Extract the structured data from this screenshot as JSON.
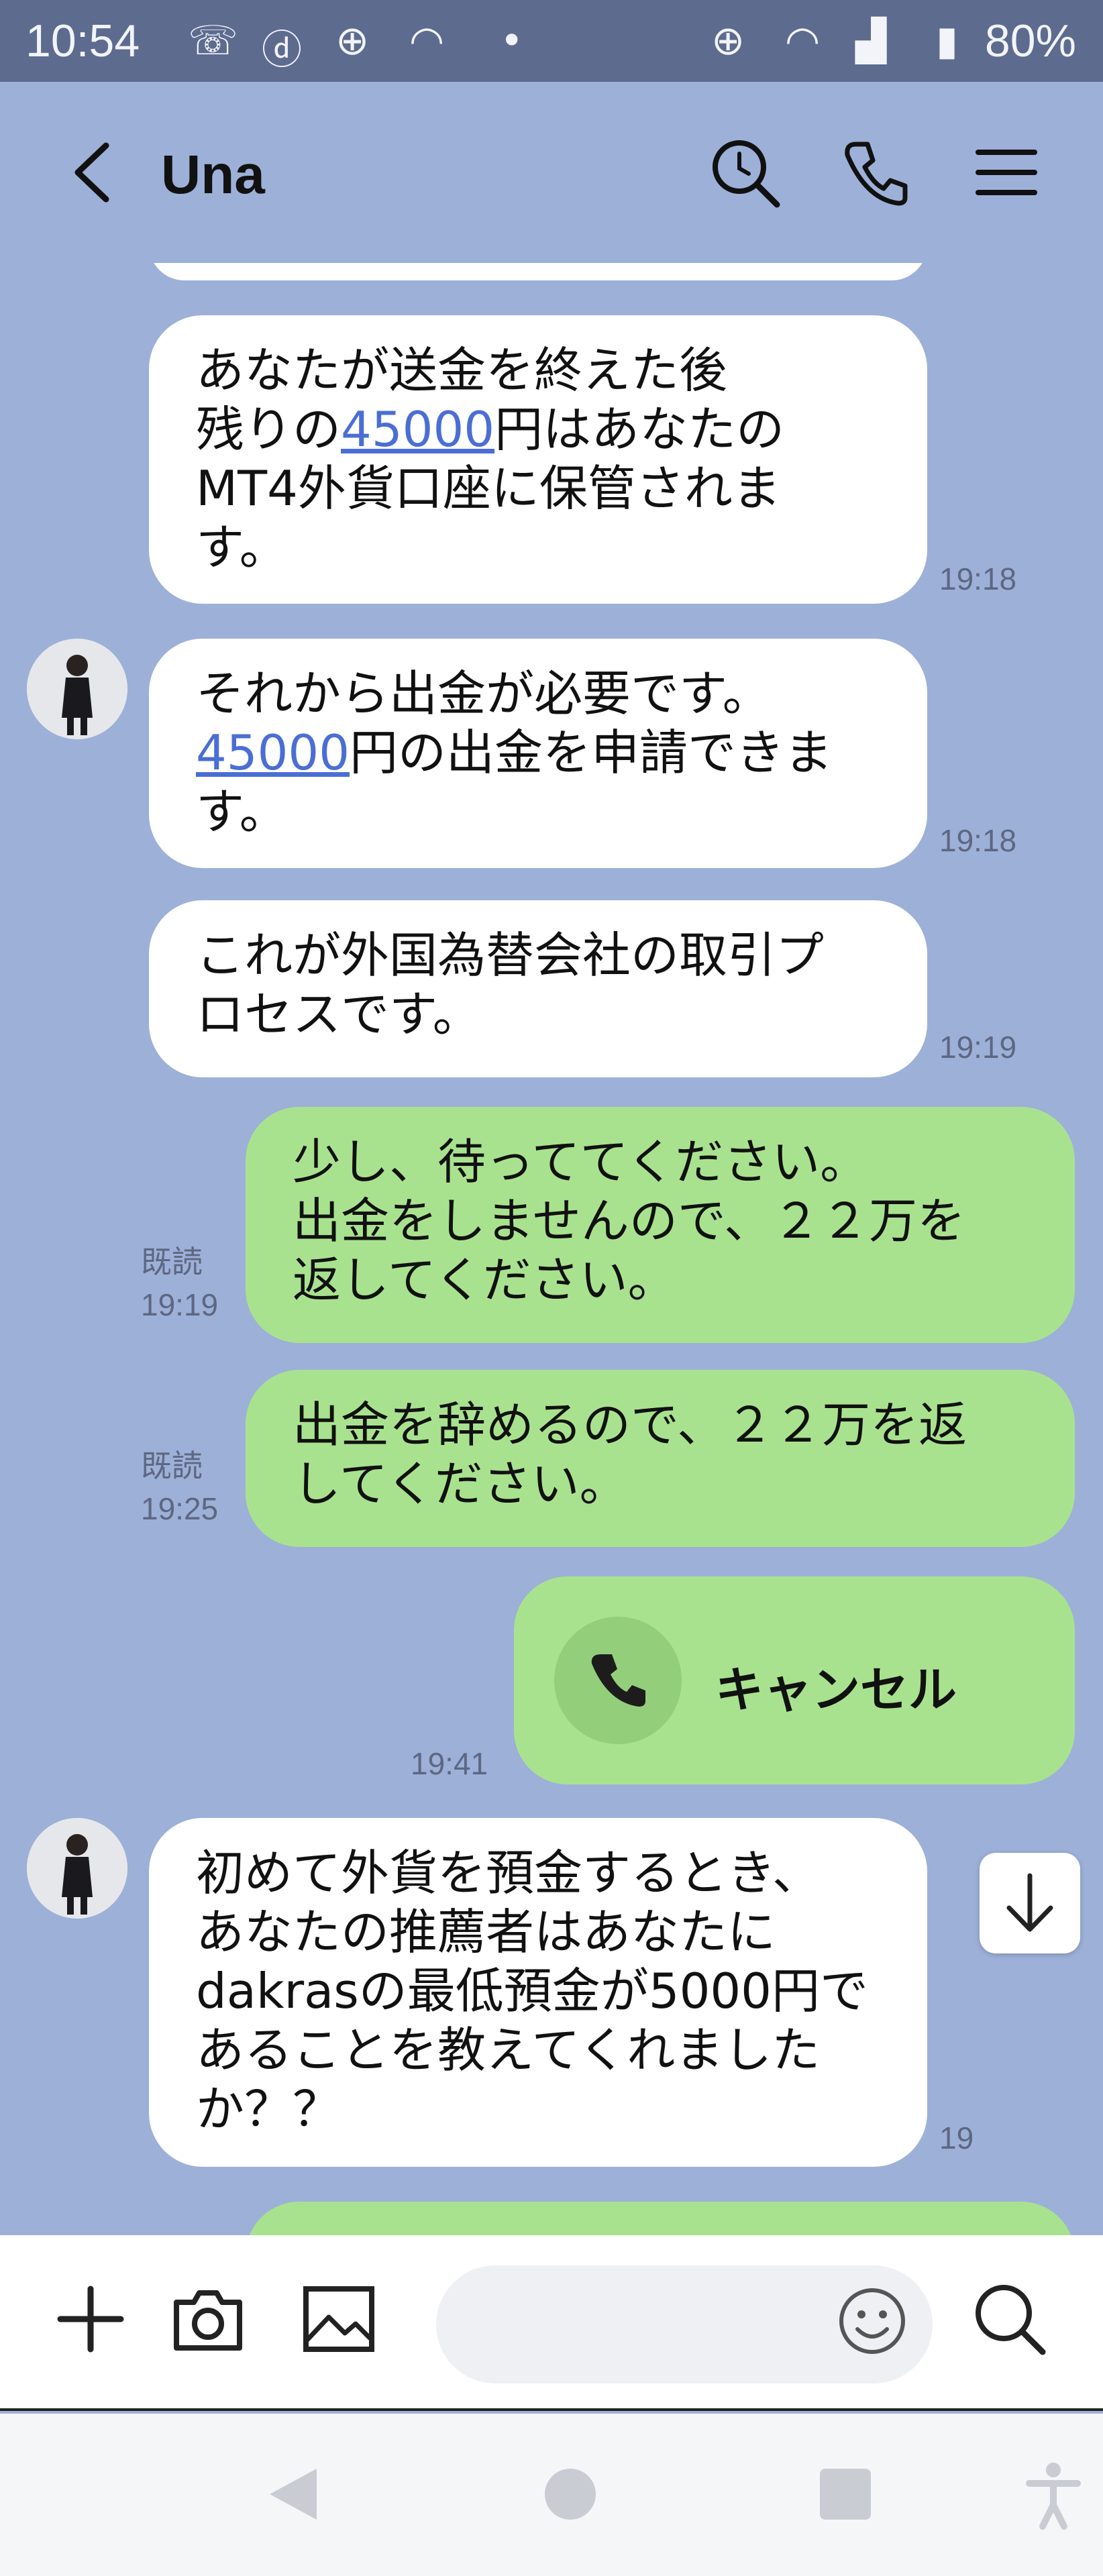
{
  "status_bar": {
    "time": "10:54",
    "battery": "80%"
  },
  "header": {
    "contact_name": "Una"
  },
  "messages": [
    {
      "direction": "in",
      "text": "あなたが送金を終えた後\n残りの45000円はあなたの\nMT4外貨口座に保管されま\nす。",
      "time": "19:18"
    },
    {
      "direction": "in",
      "text": "それから出金が必要です。\n45000円の出金を申請できま\nす。",
      "time": "19:18"
    },
    {
      "direction": "in",
      "text": "これが外国為替会社の取引プ\nロセスです。",
      "time": "19:19"
    },
    {
      "direction": "out",
      "text": "少し、待っててください。\n出金をしませんので、２２万を\n返してください。",
      "read": "既読",
      "time": "19:19"
    },
    {
      "direction": "out",
      "text": "出金を辞めるので、２２万を返\nしてください。",
      "read": "既読",
      "time": "19:25"
    },
    {
      "direction": "out",
      "type": "call",
      "text": "キャンセル",
      "time": "19:41"
    },
    {
      "direction": "in",
      "text": "初めて外貨を預金するとき、\nあなたの推薦者はあなたに\ndakrasの最低預金が5000円で\nあることを教えてくれました\nか？？",
      "time": "19"
    }
  ],
  "link_text": "45000",
  "colors": {
    "chat_bg": "#9db0d8",
    "outgoing_bubble": "#a9e28f",
    "incoming_bubble": "#ffffff",
    "link": "#4a6ed4"
  },
  "icons": {
    "back": "back-arrow-icon",
    "search": "search-icon",
    "call": "phone-icon",
    "menu": "menu-icon",
    "add": "plus-icon",
    "camera": "camera-icon",
    "image": "image-icon",
    "emoji": "emoji-icon",
    "scroll_down": "arrow-down-icon"
  }
}
